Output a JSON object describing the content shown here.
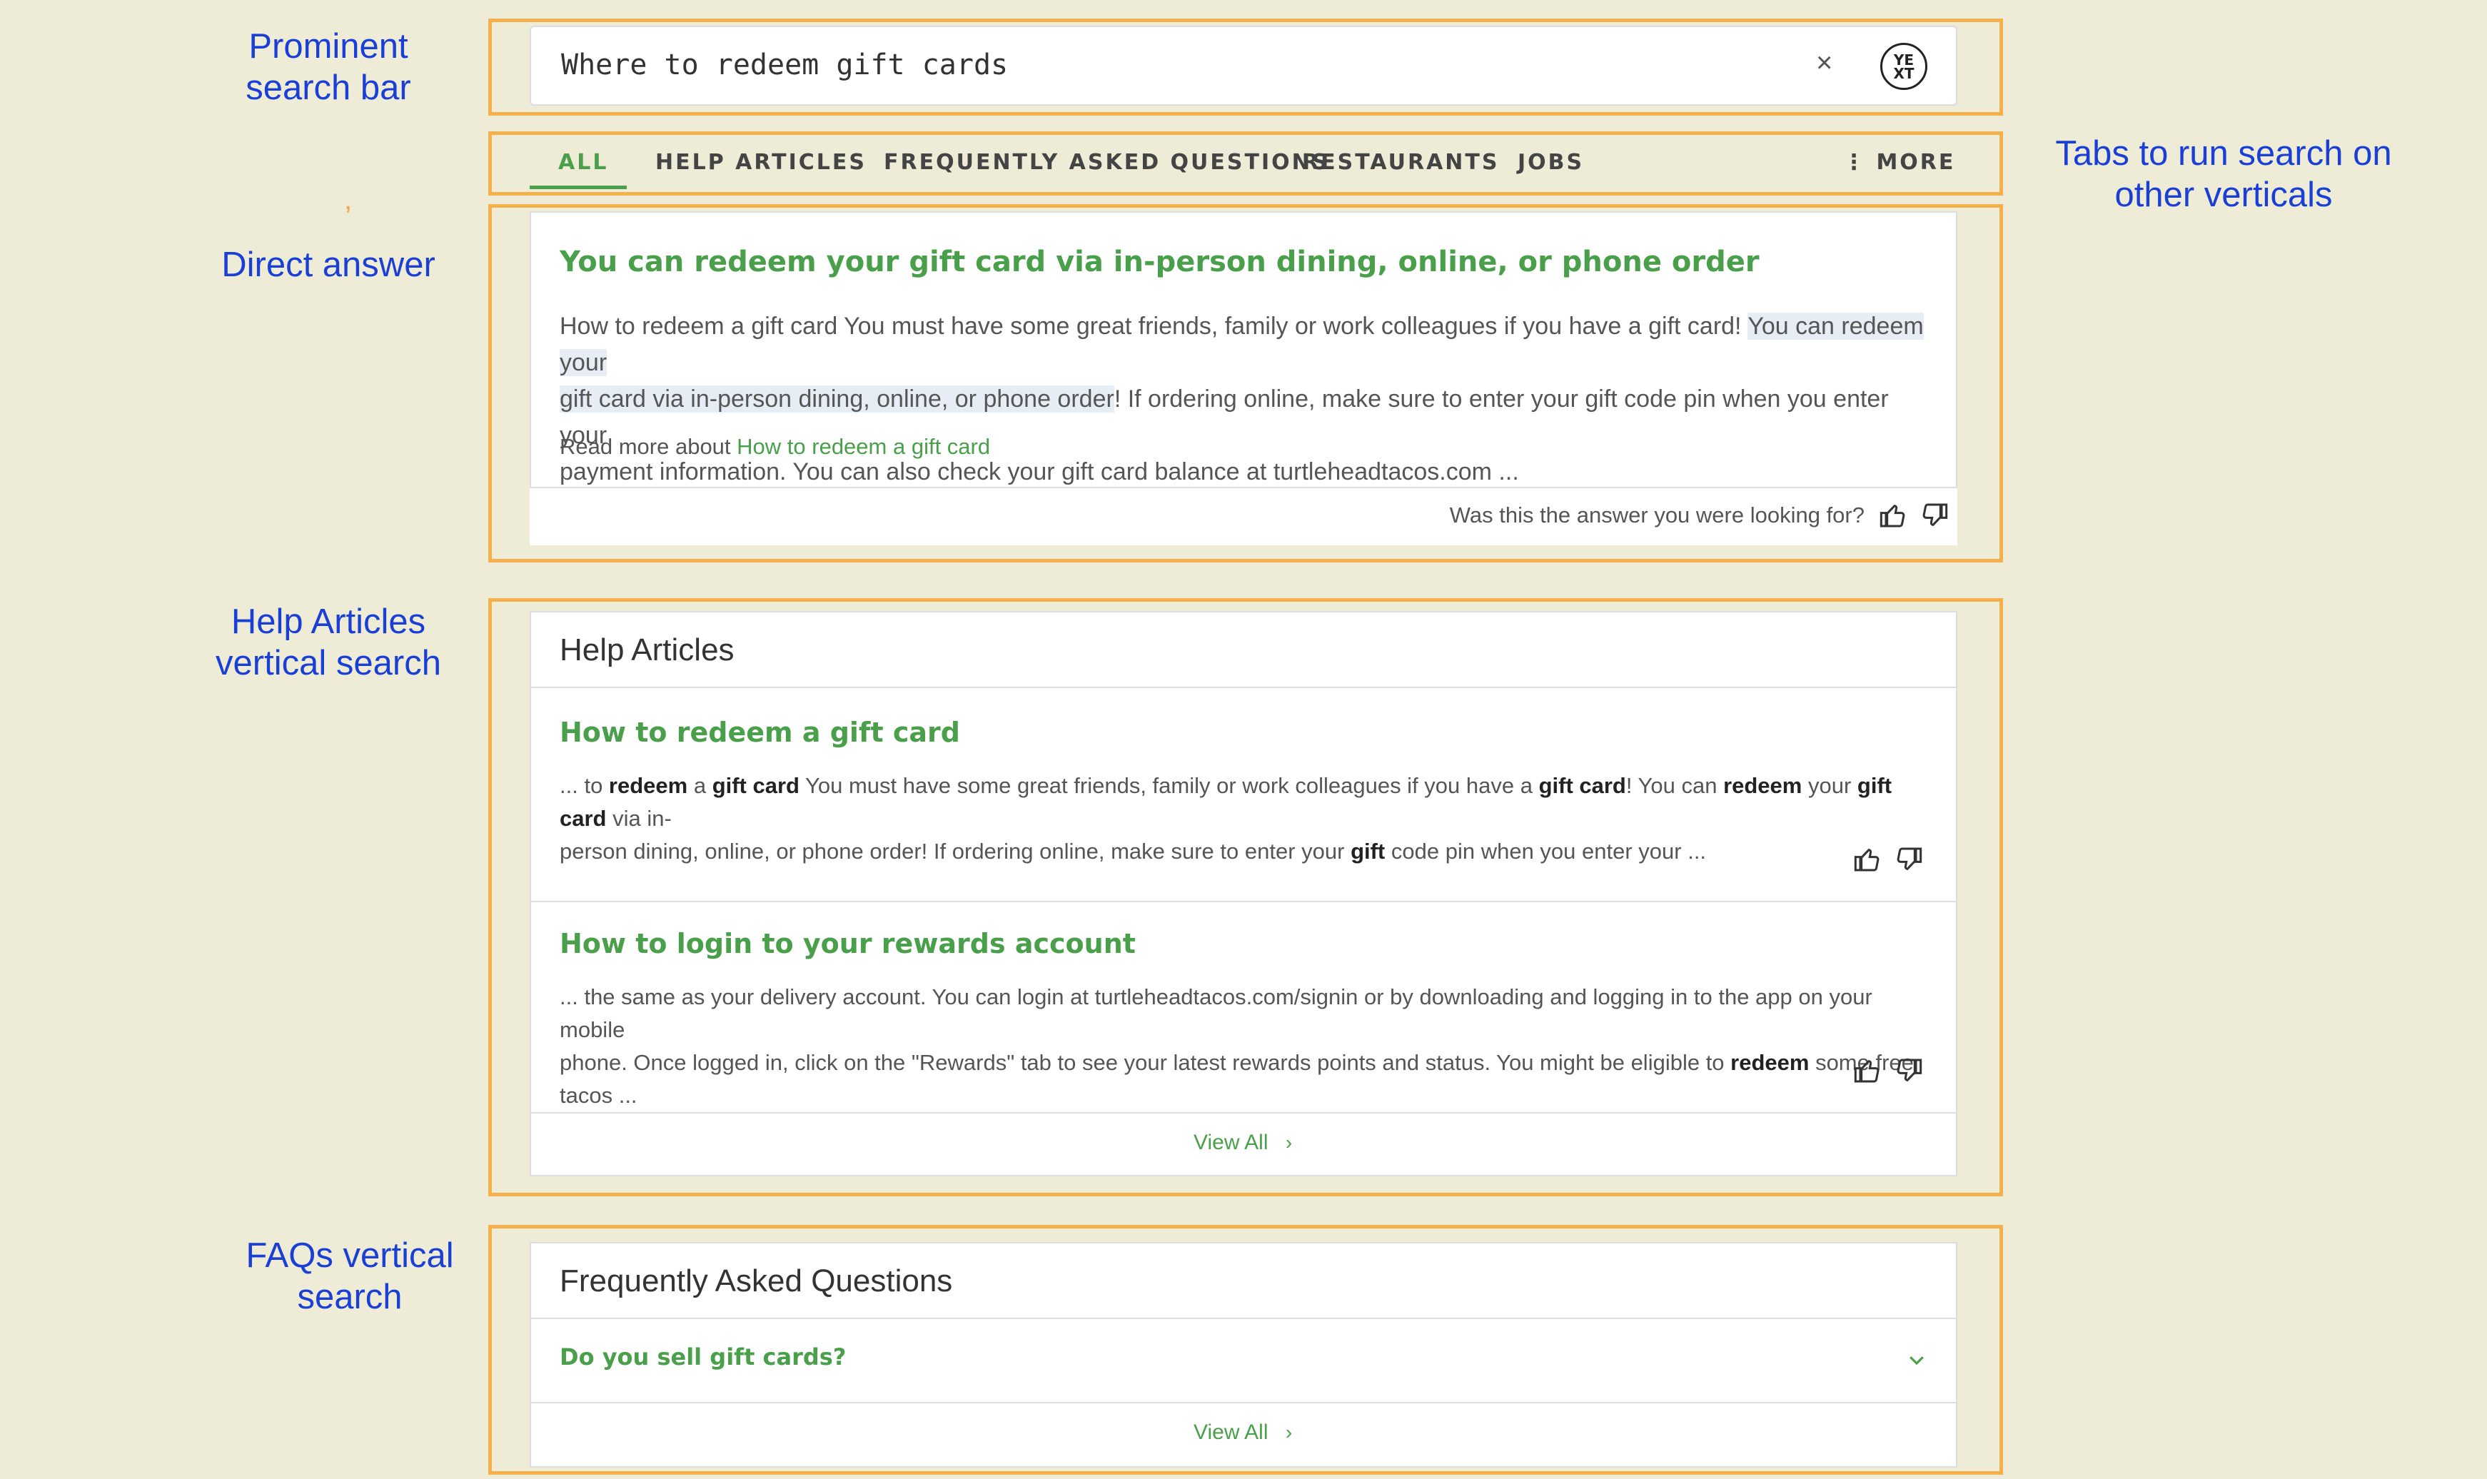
{
  "annotations": {
    "search_bar": [
      "Prominent",
      "search bar"
    ],
    "tabs": [
      "Tabs to run search on",
      "other verticals"
    ],
    "direct_answer": [
      "Direct answer"
    ],
    "help_articles": [
      "Help Articles",
      "vertical search"
    ],
    "faqs": [
      "FAQs vertical",
      "search"
    ],
    "stray_mark": ","
  },
  "search": {
    "query": "Where to redeem gift cards",
    "clear_glyph": "×",
    "logo_top": "YE",
    "logo_bottom": "XT"
  },
  "tabs": {
    "items": [
      {
        "label": "ALL"
      },
      {
        "label": "HELP ARTICLES"
      },
      {
        "label": "FREQUENTLY ASKED QUESTIONS"
      },
      {
        "label": "RESTAURANTS"
      },
      {
        "label": "JOBS"
      }
    ],
    "more_label": "⋮ MORE"
  },
  "direct_answer": {
    "title": "You can redeem your gift card via in-person dining, online, or phone order",
    "text_before": "How to redeem a gift card You must have some great friends, family or work colleagues if you have a gift card! ",
    "text_highlight_1": "You can redeem your",
    "text_highlight_2": "gift card via in-person dining, online, or phone order",
    "text_after": "! If ordering online, make sure to enter your gift code pin when you enter your",
    "text_line3": "payment information. You can also check your gift card balance at turtleheadtacos.com ...",
    "read_more_prefix": "Read more about ",
    "read_more_link": "How to redeem a gift card",
    "feedback_question": "Was this the answer you were looking for?"
  },
  "help_articles": {
    "header": "Help Articles",
    "items": [
      {
        "title": "How to redeem a gift card",
        "line1": [
          {
            "t": "... to ",
            "b": false
          },
          {
            "t": "redeem",
            "b": true
          },
          {
            "t": " a ",
            "b": false
          },
          {
            "t": "gift card",
            "b": true
          },
          {
            "t": " You must have some great friends, family or work colleagues if you have a ",
            "b": false
          },
          {
            "t": "gift card",
            "b": true
          },
          {
            "t": "! You can ",
            "b": false
          },
          {
            "t": "redeem",
            "b": true
          },
          {
            "t": " your ",
            "b": false
          },
          {
            "t": "gift card",
            "b": true
          },
          {
            "t": " via in-",
            "b": false
          }
        ],
        "line2": [
          {
            "t": "person dining, online, or phone order! If ordering online, make sure to enter your ",
            "b": false
          },
          {
            "t": "gift",
            "b": true
          },
          {
            "t": " code pin when you enter your ...",
            "b": false
          }
        ]
      },
      {
        "title": "How to login to your rewards account",
        "line1": [
          {
            "t": "... the same as your delivery account. You can login at turtleheadtacos.com/signin or by downloading and logging in to the app on your mobile",
            "b": false
          }
        ],
        "line2": [
          {
            "t": "phone. Once logged in, click on the \"Rewards\" tab to see your latest rewards points and status. You might be eligible to ",
            "b": false
          },
          {
            "t": "redeem",
            "b": true
          },
          {
            "t": " some free tacos ...",
            "b": false
          }
        ]
      }
    ],
    "view_all": "View All"
  },
  "faqs": {
    "header": "Frequently Asked Questions",
    "items": [
      {
        "question": "Do you sell gift cards?"
      }
    ],
    "view_all": "View All"
  },
  "colors": {
    "accent": "#4aa04a",
    "frame": "#f4b04c",
    "annotation": "#1a3fd6",
    "background": "#eeecd6"
  }
}
